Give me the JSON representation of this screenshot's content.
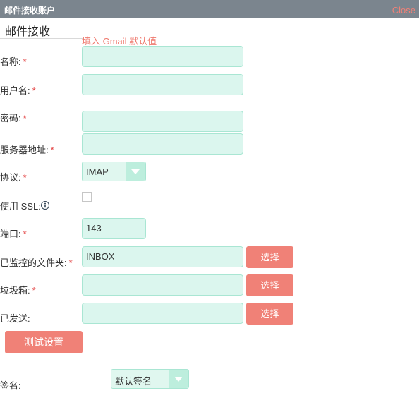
{
  "dialog": {
    "title": "邮件接收账户",
    "close_label": "Close"
  },
  "section": {
    "tab_label": "邮件接收",
    "hint": "填入 Gmail 默认值"
  },
  "fields": {
    "name_label": "名称:",
    "username_label": "用户名:",
    "password_label": "密码:",
    "server_label": "服务器地址:",
    "protocol_label": "协议:",
    "protocol_value": "IMAP",
    "ssl_label": "使用 SSL:",
    "port_label": "端口:",
    "port_value": "143",
    "monitored_label": "已监控的文件夹:",
    "monitored_value": "INBOX",
    "trash_label": "垃圾箱:",
    "sent_label": "已发送:",
    "signature_label": "签名:",
    "signature_value": "默认签名",
    "required_mark": "*"
  },
  "buttons": {
    "choose": "选择",
    "test": "测试设置"
  },
  "colors": {
    "titlebar": "#7b858e",
    "accent": "#f08177",
    "input_bg": "#dbf6ee",
    "required": "#e23b3b"
  }
}
